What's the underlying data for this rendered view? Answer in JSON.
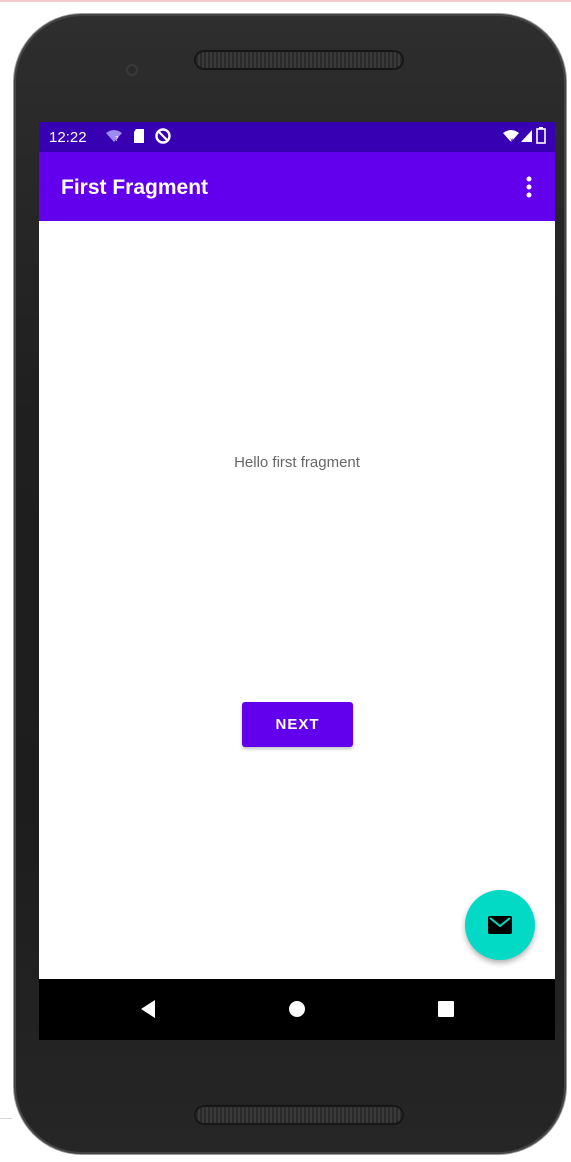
{
  "status_bar": {
    "time": "12:22",
    "left_icons": [
      "wifi-question-icon",
      "sd-card-icon",
      "data-saver-icon"
    ],
    "right_icons": [
      "wifi-icon",
      "cell-signal-icon",
      "battery-icon"
    ],
    "background": "#3700b3"
  },
  "app_bar": {
    "title": "First Fragment",
    "overflow_icon": "more-vert-icon",
    "background": "#6200ee"
  },
  "content": {
    "hello_text": "Hello first fragment",
    "next_button_label": "NEXT",
    "button_color": "#6200ee"
  },
  "fab": {
    "icon": "email-icon",
    "color": "#03dac5"
  },
  "nav_bar": {
    "icons": [
      "back-icon",
      "home-icon",
      "recents-icon"
    ]
  }
}
